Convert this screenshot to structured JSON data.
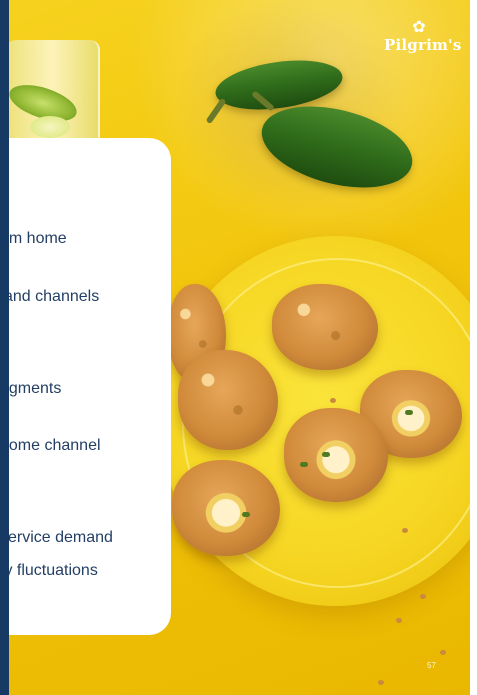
{
  "brand": {
    "logo_text": "Pilgrim's",
    "logo_icon": "rooster-icon",
    "accent_navy": "#163a63",
    "background_yellow": "#f2c50c"
  },
  "content_card": {
    "bullets": [
      "om home",
      "and channels",
      "egments",
      "home channel",
      "service demand",
      "ty fluctuations"
    ]
  },
  "footer": {
    "page_number": "57"
  }
}
